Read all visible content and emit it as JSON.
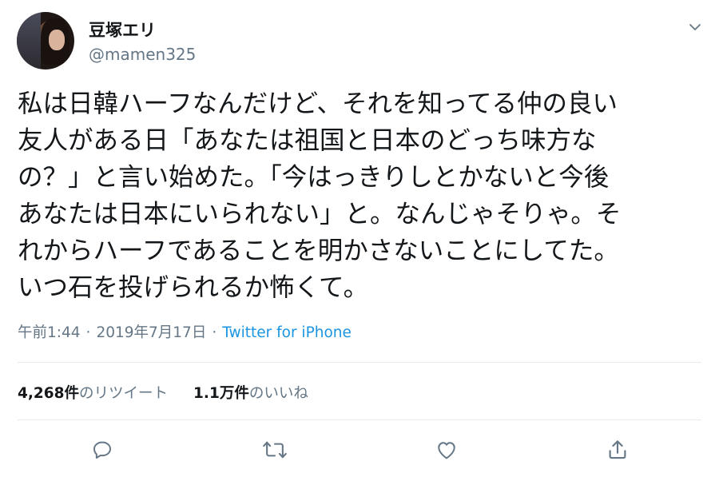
{
  "user": {
    "display_name": "豆塚エリ",
    "username": "@mamen325"
  },
  "tweet": {
    "text": "私は日韓ハーフなんだけど、それを知ってる仲の良い\n友人がある日「あなたは祖国と日本のどっち味方な\nの？」と言い始めた。「今はっきりしとかないと今後\nあなたは日本にいられない」と。なんじゃそりゃ。そ\nれからハーフであることを明かさないことにしてた。\nいつ石を投げられるか怖くて。",
    "time": "午前1:44",
    "date": "2019年7月17日",
    "separator": "·",
    "source": "Twitter for iPhone"
  },
  "stats": {
    "retweets_count": "4,268件",
    "retweets_label": "のリツイート",
    "likes_count": "1.1万件",
    "likes_label": "のいいね"
  },
  "icons": {
    "menu": "chevron-down-icon",
    "reply": "reply-icon",
    "retweet": "retweet-icon",
    "like": "heart-icon",
    "share": "share-icon"
  },
  "colors": {
    "text": "#14171a",
    "secondary": "#657786",
    "link": "#1b95e0",
    "divider": "#e6ecf0"
  }
}
